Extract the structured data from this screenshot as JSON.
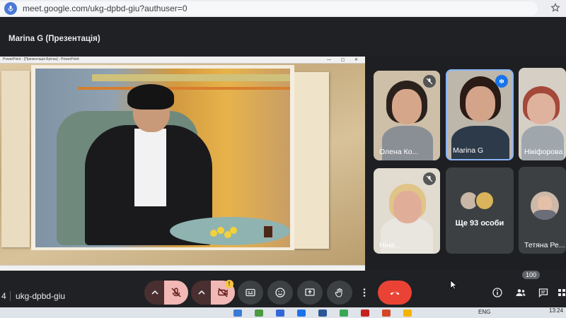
{
  "browser": {
    "url": "meet.google.com/ukg-dpbd-giu?authuser=0"
  },
  "meet": {
    "presenter_title": "Marina G (Презентація)",
    "presentation": {
      "window_title": "PowerPoint - [Презентація Брітан] - PowerPoint"
    },
    "participants": [
      {
        "name": "Олена Ко...",
        "muted": true
      },
      {
        "name": "Marina G",
        "speaking": true
      },
      {
        "name": "Нікіфорова"
      },
      {
        "name": "Ніна...",
        "muted": true
      },
      {
        "name": "Ще 93 особи"
      },
      {
        "name": "Тетяна Ре..."
      }
    ],
    "bottom": {
      "time_fragment": "4",
      "meeting_code": "ukg-dpbd-giu",
      "participants_badge": "100",
      "camera_alert": "!"
    },
    "controls": [
      {
        "name": "mic",
        "icon": "mic-off-icon"
      },
      {
        "name": "camera",
        "icon": "camera-off-icon"
      },
      {
        "name": "captions",
        "icon": "captions-icon"
      },
      {
        "name": "reactions",
        "icon": "emoji-icon"
      },
      {
        "name": "present",
        "icon": "present-screen-icon"
      },
      {
        "name": "raise-hand",
        "icon": "hand-icon"
      },
      {
        "name": "more",
        "icon": "more-vert-icon"
      },
      {
        "name": "leave",
        "icon": "hang-up-icon"
      }
    ]
  },
  "taskbar": {
    "lang": "ENG",
    "clock": "13:24"
  },
  "colors": {
    "meet_bg": "#202124",
    "tile_bg": "#3c4043",
    "mute_active": "#f2b8b5",
    "end_call": "#ea4335",
    "speaking_ring": "#8ab4f8"
  }
}
